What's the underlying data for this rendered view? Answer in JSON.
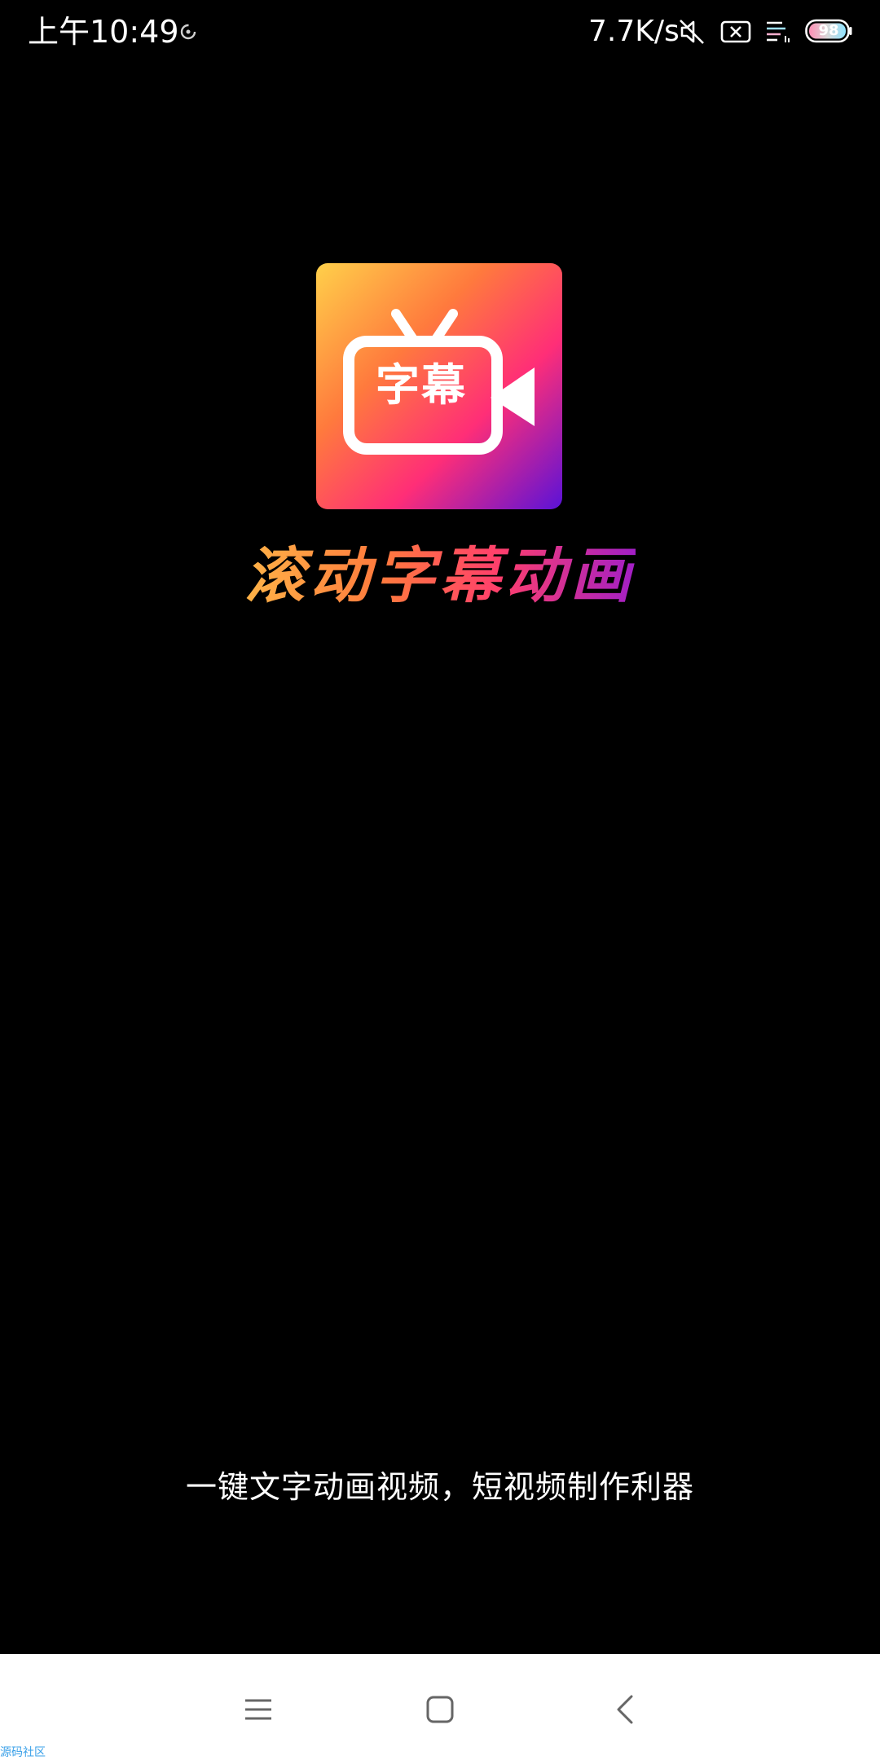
{
  "status_bar": {
    "time": "上午10:49",
    "network_speed": "7.7K/s",
    "battery_level": "98",
    "icons": [
      "sync-icon",
      "mute-icon",
      "x-box-icon",
      "signal-icon",
      "battery-icon"
    ]
  },
  "splash": {
    "logo_badge_text": "字幕",
    "app_name": "滚动字幕动画",
    "slogan": "一键文字动画视频，短视频制作利器"
  },
  "nav_bar": {
    "buttons": [
      "menu-icon",
      "home-icon",
      "back-icon"
    ]
  },
  "watermark": "源码社区",
  "colors": {
    "background": "#000000",
    "nav_bar_background": "#ffffff",
    "logo_gradient": [
      "#ffd04a",
      "#ff7a3d",
      "#ff2e77",
      "#5a12d8"
    ],
    "title_gradient": [
      "#ffb347",
      "#ff3f6c",
      "#a21fc6"
    ],
    "watermark": "#3aa0e8"
  }
}
